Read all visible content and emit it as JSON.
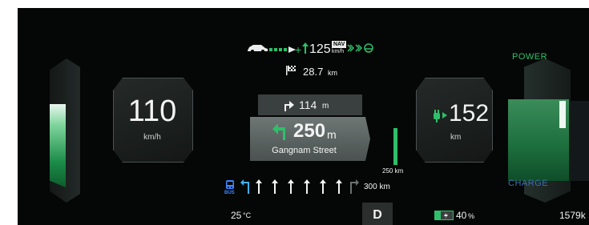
{
  "speed": {
    "value": "110",
    "unit": "km/h"
  },
  "range": {
    "value": "152",
    "unit": "km"
  },
  "power_label": "POWER",
  "charge_label": "CHARGE",
  "adas": {
    "set_speed": "125",
    "nav_badge": "NAV",
    "set_unit": "km/h"
  },
  "destination": {
    "value": "28.7",
    "unit": "km"
  },
  "next_turn": {
    "value": "114",
    "unit": "m"
  },
  "main_turn": {
    "value": "250",
    "unit": "m",
    "street": "Gangnam Street"
  },
  "distance_bar": {
    "label": "250 km",
    "fill": 1.0
  },
  "lanes": {
    "count_label": "300 km",
    "bus_label": "BUS"
  },
  "status": {
    "temperature": "25",
    "temp_unit": "°C",
    "gear": "D",
    "battery": "40",
    "battery_unit": "%",
    "odometer": "1579k"
  },
  "colors": {
    "accent_green": "#2fbf6a",
    "lane_blue": "#3f86ff",
    "power_green": "#2fbf6a",
    "charge_blue": "#3b6fb0"
  },
  "icons": [
    "car-icon",
    "lane-assist-icon",
    "flag-icon",
    "turn-right-icon",
    "turn-left-icon",
    "plug-icon",
    "bus-icon",
    "battery-icon"
  ]
}
